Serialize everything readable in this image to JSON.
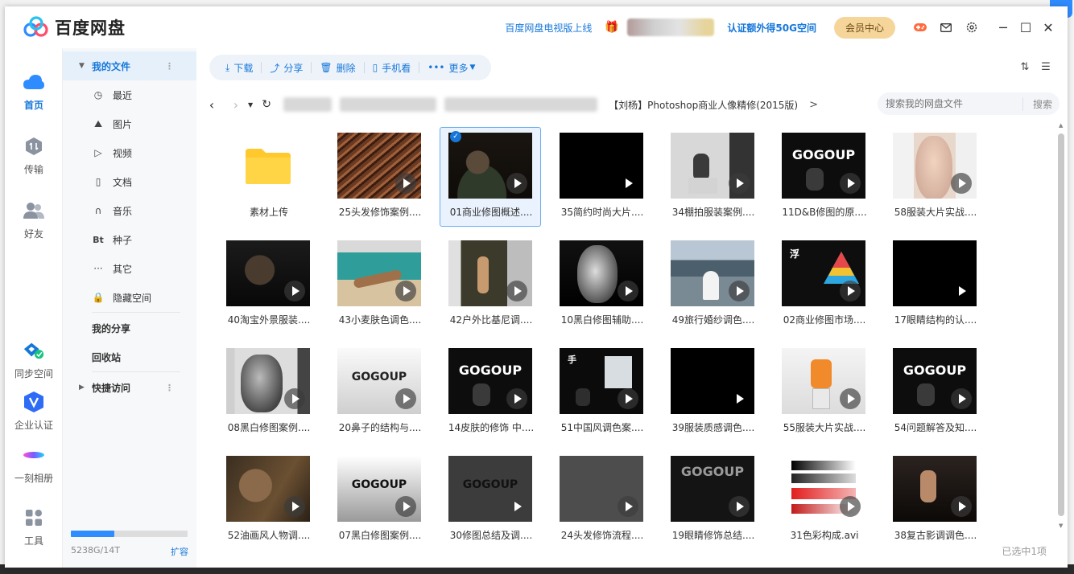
{
  "app": {
    "title": "百度网盘"
  },
  "header": {
    "tv_link": "百度网盘电视版上线",
    "auth_link": "认证额外得50G空间",
    "vip_button": "会员中心",
    "icons": [
      "gift-icon",
      "game-icon",
      "mail-icon",
      "settings-icon"
    ],
    "controls": [
      "minimize-icon",
      "maximize-icon",
      "close-icon"
    ]
  },
  "nav": {
    "home": "首页",
    "transfer": "传输",
    "friends": "好友",
    "sync": "同步空间",
    "enterprise": "企业认证",
    "album": "一刻相册",
    "tools": "工具"
  },
  "sidebar": {
    "my_files": "我的文件",
    "items": [
      {
        "label": "最近",
        "icon": "clock-icon"
      },
      {
        "label": "图片",
        "icon": "picture-icon"
      },
      {
        "label": "视频",
        "icon": "play-icon"
      },
      {
        "label": "文档",
        "icon": "document-icon"
      },
      {
        "label": "音乐",
        "icon": "headphones-icon"
      },
      {
        "label": "种子",
        "icon": "bt-icon"
      },
      {
        "label": "其它",
        "icon": "more-icon"
      },
      {
        "label": "隐藏空间",
        "icon": "lock-icon"
      }
    ],
    "my_share": "我的分享",
    "recycle": "回收站",
    "quick_access": "快捷访问",
    "quota_text": "5238G/14T",
    "quota_fraction": 0.37,
    "expand": "扩容"
  },
  "toolbar": {
    "download": "下载",
    "share": "分享",
    "delete": "删除",
    "phone": "手机看",
    "more": "更多"
  },
  "path": {
    "current": "【刘杨】Photoshop商业人像精修(2015版)",
    "search_placeholder": "搜索我的网盘文件",
    "search_button": "搜索"
  },
  "files": [
    {
      "name": "素材上传",
      "type": "folder"
    },
    {
      "name": "25头发修饰案例....",
      "type": "video",
      "art": "hair"
    },
    {
      "name": "01商业修图概述....",
      "type": "video",
      "art": "man",
      "selected": true
    },
    {
      "name": "35简约时尚大片....",
      "type": "video",
      "art": "black"
    },
    {
      "name": "34棚拍服装案例....",
      "type": "video",
      "art": "studio"
    },
    {
      "name": "11D&B修图的原....",
      "type": "video",
      "art": "gogo"
    },
    {
      "name": "58服装大片实战....",
      "type": "video",
      "art": "face"
    },
    {
      "name": "40淘宝外景服装....",
      "type": "video",
      "art": "man2"
    },
    {
      "name": "43小麦肤色调色....",
      "type": "video",
      "art": "beach"
    },
    {
      "name": "42户外比基尼调....",
      "type": "video",
      "art": "outdoor"
    },
    {
      "name": "10黑白修图辅助....",
      "type": "video",
      "art": "bwface"
    },
    {
      "name": "49旅行婚纱调色....",
      "type": "video",
      "art": "lake"
    },
    {
      "name": "02商业修图市场....",
      "type": "video",
      "art": "pyramid"
    },
    {
      "name": "17眼睛结构的认....",
      "type": "video",
      "art": "black"
    },
    {
      "name": "08黑白修图案例....",
      "type": "video",
      "art": "bwman"
    },
    {
      "name": "20鼻子的结构与....",
      "type": "video",
      "art": "gogo-light"
    },
    {
      "name": "14皮肤的修饰 中....",
      "type": "video",
      "art": "gogo"
    },
    {
      "name": "51中国风调色案....",
      "type": "video",
      "art": "stage"
    },
    {
      "name": "39服装质感调色....",
      "type": "video",
      "art": "black"
    },
    {
      "name": "55服装大片实战....",
      "type": "video",
      "art": "orange"
    },
    {
      "name": "54问题解答及知....",
      "type": "video",
      "art": "gogo"
    },
    {
      "name": "52油画风人物调....",
      "type": "video",
      "art": "oil"
    },
    {
      "name": "07黑白修图案例....",
      "type": "video",
      "art": "gogo-gray"
    },
    {
      "name": "30修图总结及调....",
      "type": "video",
      "art": "gogo-dark"
    },
    {
      "name": "24头发修饰流程....",
      "type": "video",
      "art": "gray"
    },
    {
      "name": "19眼睛修饰总结....",
      "type": "video",
      "art": "gogo-dim"
    },
    {
      "name": "31色彩构成.avi",
      "type": "video",
      "art": "gradient"
    },
    {
      "name": "38复古影调调色....",
      "type": "video",
      "art": "retro"
    }
  ],
  "gogo_text": "GOGOUP",
  "status": "已选中1项",
  "colors": {
    "accent": "#1677d9",
    "selection": "#e9f2fd",
    "vip": "#f6d59b",
    "folder": "#ffd042"
  }
}
